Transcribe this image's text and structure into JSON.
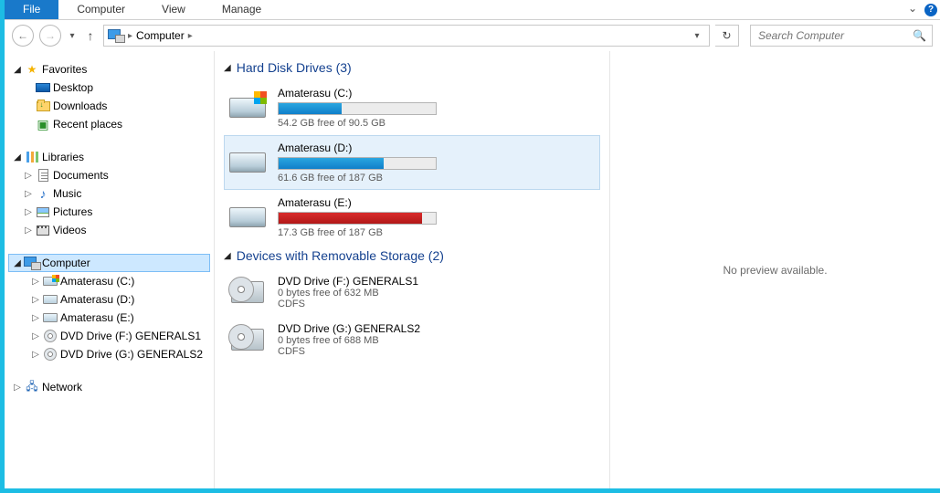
{
  "ribbon": {
    "file": "File",
    "tabs": [
      "Computer",
      "View",
      "Manage"
    ]
  },
  "nav": {
    "location": "Computer",
    "search_placeholder": "Search Computer"
  },
  "tree": {
    "favorites": {
      "label": "Favorites",
      "items": [
        "Desktop",
        "Downloads",
        "Recent places"
      ]
    },
    "libraries": {
      "label": "Libraries",
      "items": [
        "Documents",
        "Music",
        "Pictures",
        "Videos"
      ]
    },
    "computer": {
      "label": "Computer",
      "items": [
        "Amaterasu (C:)",
        "Amaterasu (D:)",
        "Amaterasu (E:)",
        "DVD Drive (F:) GENERALS1",
        "DVD Drive (G:) GENERALS2"
      ]
    },
    "network": {
      "label": "Network"
    }
  },
  "groups": {
    "hdd": {
      "label": "Hard Disk Drives (3)",
      "drives": [
        {
          "name": "Amaterasu (C:)",
          "sub": "54.2 GB free of 90.5 GB",
          "fill_pct": 40,
          "color": "blue",
          "os": true,
          "selected": false
        },
        {
          "name": "Amaterasu (D:)",
          "sub": "61.6 GB free of 187 GB",
          "fill_pct": 67,
          "color": "blue",
          "os": false,
          "selected": true
        },
        {
          "name": "Amaterasu (E:)",
          "sub": "17.3 GB free of 187 GB",
          "fill_pct": 91,
          "color": "red",
          "os": false,
          "selected": false
        }
      ]
    },
    "removable": {
      "label": "Devices with Removable Storage (2)",
      "drives": [
        {
          "name": "DVD Drive (F:) GENERALS1",
          "sub": "0 bytes free of 632 MB",
          "fs": "CDFS"
        },
        {
          "name": "DVD Drive (G:) GENERALS2",
          "sub": "0 bytes free of 688 MB",
          "fs": "CDFS"
        }
      ]
    }
  },
  "preview": {
    "text": "No preview available."
  }
}
